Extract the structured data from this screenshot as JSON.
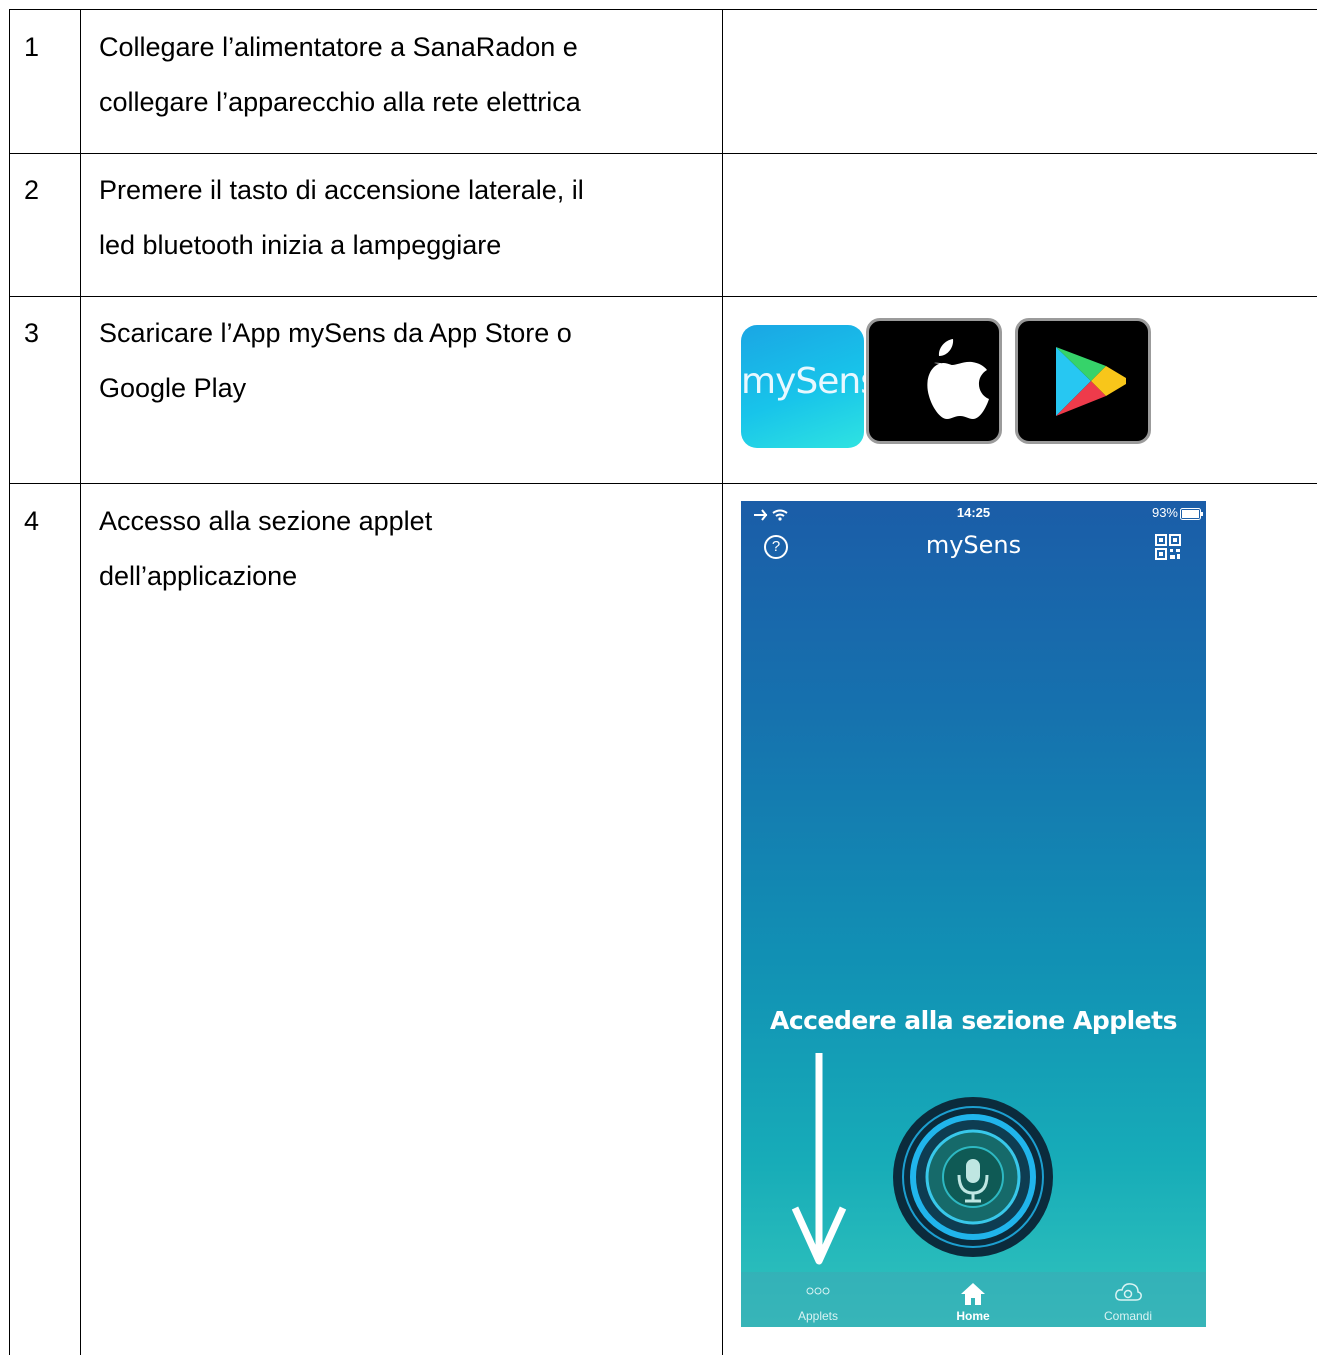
{
  "rows": [
    {
      "num": "1",
      "lines": [
        "Collegare l’alimentatore a SanaRadon e",
        "collegare l’apparecchio alla rete elettrica"
      ]
    },
    {
      "num": "2",
      "lines": [
        "Premere il tasto di accensione laterale, il",
        "led bluetooth inizia a lampeggiare"
      ]
    },
    {
      "num": "3",
      "lines": [
        "Scaricare l’App mySens da App Store o",
        "Google Play"
      ]
    },
    {
      "num": "4",
      "lines": [
        "Accesso alla sezione applet",
        "dell’applicazione"
      ]
    }
  ],
  "app_icons": {
    "mysens_label": "mySens",
    "apple_icon": "apple-logo",
    "play_icon": "google-play-logo"
  },
  "phone": {
    "status_time": "14:25",
    "status_battery": "93%",
    "app_title": "mySens",
    "help_glyph": "?",
    "hint": "Accedere alla sezione Applets",
    "tabs": [
      {
        "label": "Applets",
        "icon": "dots-icon"
      },
      {
        "label": "Home",
        "icon": "home-icon"
      },
      {
        "label": "Comandi",
        "icon": "cloud-gear-icon"
      }
    ]
  }
}
